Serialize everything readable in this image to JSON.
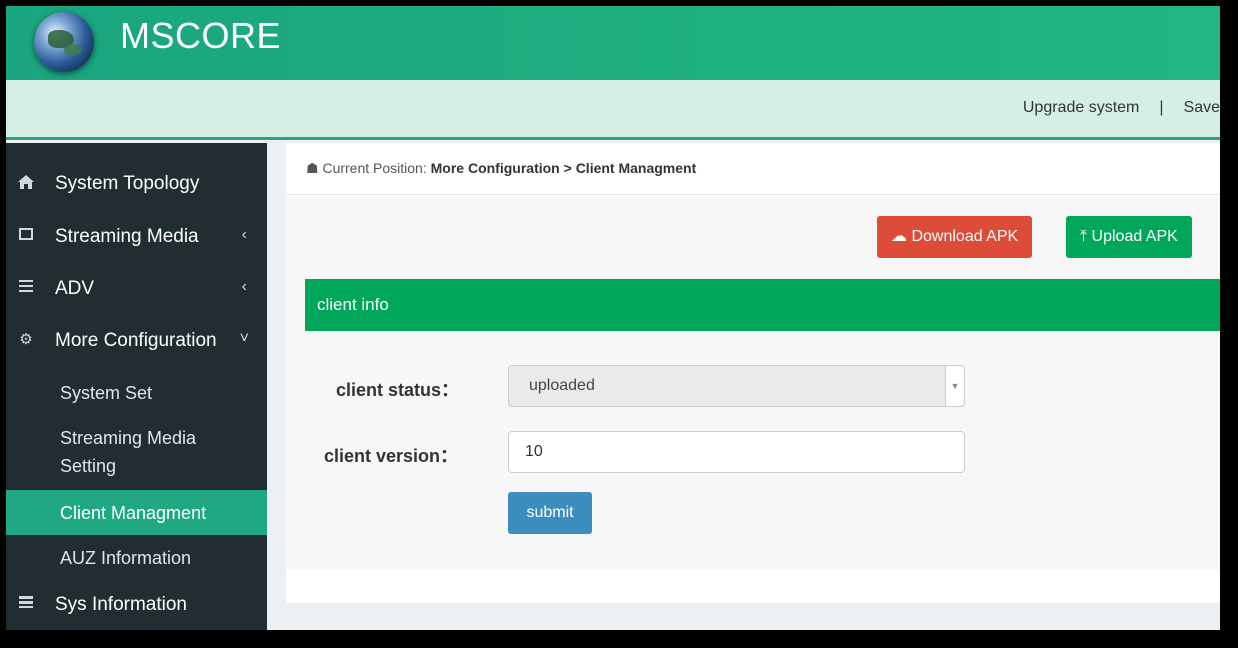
{
  "header": {
    "title": "MSCORE",
    "links": [
      "Upgrade system",
      "|",
      "Save"
    ]
  },
  "sidebar": {
    "items": [
      {
        "label": "System Topology",
        "icon": "home-icon"
      },
      {
        "label": "Streaming Media",
        "icon": "film-icon",
        "chevron": "‹"
      },
      {
        "label": "ADV",
        "icon": "list-icon",
        "chevron": "‹"
      },
      {
        "label": "More Configuration",
        "icon": "cogs-icon",
        "chevron": "˅"
      }
    ],
    "subitems": [
      "System Set",
      "Streaming Media Setting",
      "Client Managment",
      "AUZ Information"
    ],
    "bottom_item": {
      "label": "Sys Information",
      "icon": "server-icon"
    }
  },
  "breadcrumb": {
    "prefix": "Current Position:",
    "section": "More Configuration",
    "page": "> Client Managment"
  },
  "toolbar": {
    "download_label": "Download APK",
    "upload_label": "Upload APK"
  },
  "panel": {
    "title": "client info",
    "status_label": "client status：",
    "status_value": "uploaded",
    "version_label": "client version：",
    "version_value": "10",
    "submit_label": "submit"
  },
  "colors": {
    "header": "#1fb080",
    "sidebar": "#222d32",
    "active": "#1fa882",
    "danger": "#dd4b39",
    "success": "#00a65a",
    "primary": "#3c8dbc"
  }
}
